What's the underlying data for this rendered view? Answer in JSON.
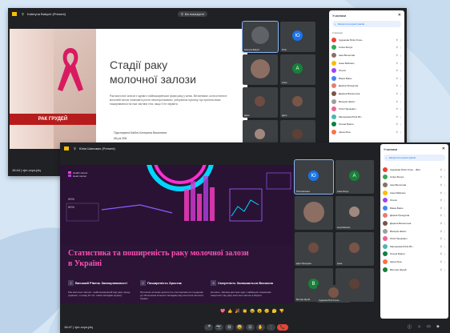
{
  "window1": {
    "presenter": "Kateryna Babych (Present)",
    "present_chip": "Ви показуєте",
    "slide": {
      "title_line1": "Стадії раку",
      "title_line2": "молочної залози",
      "body": "Рак молочної залози є одним з найпоширеніших форм раку у жінок. Він виникає, коли клітини в молочній залозі починають рости неконтрольовано, утворюючи пухлину. Ця пухлина може поширюватися на інші частини тіла, якщо її не лікувати.",
      "author": "Підготувала Бабич Катерина Василівна",
      "group": "МЦ-м 306",
      "ribbon_caption": "РАК ГРУДЕЙ"
    },
    "tiles": [
      {
        "name": "Kateryna Babych",
        "avatar": "",
        "color": "#5f6368"
      },
      {
        "name": "Юлія",
        "avatar": "Ю",
        "color": "#1a73e8"
      },
      {
        "name": "",
        "avatar": "",
        "color": "#8d6e63"
      },
      {
        "name": "Аліна",
        "avatar": "А",
        "color": "#188038"
      },
      {
        "name": "Діана",
        "avatar": "",
        "color": "#6d4c41"
      },
      {
        "name": "Дар'я",
        "avatar": "",
        "color": "#795548"
      },
      {
        "name": "",
        "avatar": "",
        "color": "#a1887f"
      },
      {
        "name": "Юлія",
        "avatar": "",
        "color": "#5d4037"
      }
    ],
    "footer_left": "16:44  |  vjm-xvyn-jdq",
    "people_panel": {
      "title": "Учасники",
      "add_button": "Запросити користувачів",
      "section": "Учасники",
      "rows": [
        {
          "name": "Чудакова Юлія Олек...",
          "color": "#ea4335"
        },
        {
          "name": "Аліна Зінчук",
          "color": "#34a853"
        },
        {
          "name": "Інна Веселова",
          "color": "#8d6e63"
        },
        {
          "name": "Анна Бабенко",
          "color": "#fbbc04"
        },
        {
          "name": "Олеся",
          "color": "#a142f4"
        },
        {
          "name": "Біжна Біжко",
          "color": "#4285f4"
        },
        {
          "name": "Даріна Прокурінa",
          "color": "#e67c73"
        },
        {
          "name": "Дарина Валентина",
          "color": "#795548"
        },
        {
          "name": "Валерія Шокот",
          "color": "#9e9e9e"
        },
        {
          "name": "Лілія Пашкевич",
          "color": "#f06292"
        },
        {
          "name": "Маленкова Юлія Віт...",
          "color": "#4db6ac"
        },
        {
          "name": "Олена Брагін",
          "color": "#0b8043"
        },
        {
          "name": "Ірина Лесь",
          "color": "#ff7043"
        }
      ]
    }
  },
  "window2": {
    "presenter": "Юлія Шаповал (Present)",
    "slide": {
      "title": "Статистика та поширеність раку молочної залози в Україні",
      "legend": [
        "Health cancer",
        "Heart cancer"
      ],
      "axis_labels": [
        "90%",
        "50%"
      ],
      "columns": [
        {
          "num": "1",
          "heading": "Високий Рівень Захворюваності",
          "text": "Рак молочної залози - найпоширеніший вид раку серед українок, з понад 16 тис. нових випадків щороку."
        },
        {
          "num": "2",
          "heading": "Поширеність Зростає",
          "text": "Протягом останніх десятиліть спостерігається тенденція до збільшення кількості випадків раку молочної залози в Україні."
        },
        {
          "num": "3",
          "heading": "Смертність Залишається Високою",
          "text": "На жаль, Україна досі має одні з найвищих показників смертності від раку молочної залози в Європі."
        }
      ]
    },
    "tiles": [
      {
        "name": "Юлія Шаповал",
        "avatar": "Ю",
        "color": "#1a73e8"
      },
      {
        "name": "Аліна Зінчук",
        "avatar": "А",
        "color": "#188038"
      },
      {
        "name": "",
        "avatar": "",
        "color": "#8d6e63"
      },
      {
        "name": "Анна Бабенко",
        "avatar": "",
        "color": "#a1887f"
      },
      {
        "name": "Дар'я Прокурінa",
        "avatar": "",
        "color": "#6d4c41"
      },
      {
        "name": "Ірина",
        "avatar": "",
        "color": "#795548"
      },
      {
        "name": "Вікторія Шугай",
        "avatar": "В",
        "color": "#188038"
      },
      {
        "name": "",
        "avatar": "",
        "color": "#5d4037"
      }
    ],
    "self_view_name": "Чудакова Юлія Олекс...",
    "footer_left": "16:47  |  vjm-xvyn-jdq",
    "reactions": [
      "💖",
      "👍",
      "🎉",
      "👏",
      "😂",
      "😮",
      "😢",
      "🤔",
      "👎"
    ],
    "controls": [
      "🎤",
      "📷",
      "⊟",
      "😀",
      "⊡",
      "✋",
      "⋮",
      "📞"
    ],
    "people_panel": {
      "title": "Учасники",
      "add_button": "Запросити користувачів",
      "rows": [
        {
          "name": "Чудакова Юлія Олек... (Ви)",
          "color": "#ea4335"
        },
        {
          "name": "Аліна Зінчук",
          "color": "#34a853"
        },
        {
          "name": "Інна Веселова",
          "color": "#8d6e63"
        },
        {
          "name": "Анна Бабенко",
          "color": "#fbbc04"
        },
        {
          "name": "Олеся",
          "color": "#a142f4"
        },
        {
          "name": "Біжна Біжко",
          "color": "#4285f4"
        },
        {
          "name": "Даріна Прокурінa",
          "color": "#e67c73"
        },
        {
          "name": "Дарина Валентина",
          "color": "#795548"
        },
        {
          "name": "Валерія Шокот",
          "color": "#9e9e9e"
        },
        {
          "name": "Лілія Пашкевич",
          "color": "#f06292"
        },
        {
          "name": "Маленкова Юлія Віт...",
          "color": "#4db6ac"
        },
        {
          "name": "Олена Брагін",
          "color": "#0b8043"
        },
        {
          "name": "Ірина Лесь",
          "color": "#ff7043"
        },
        {
          "name": "Вікторія Шугай",
          "color": "#188038"
        }
      ]
    }
  }
}
